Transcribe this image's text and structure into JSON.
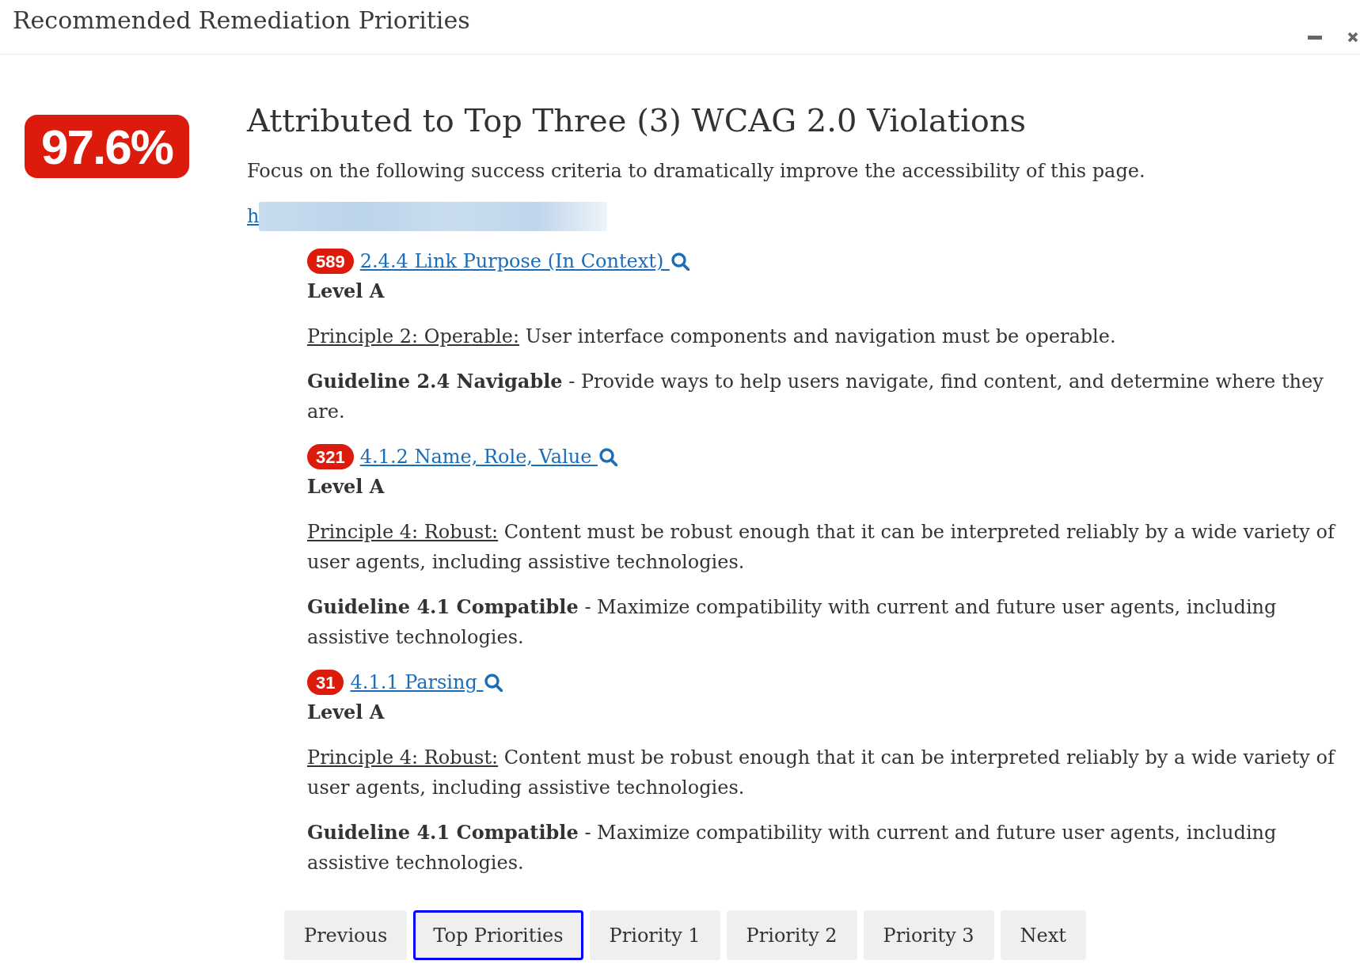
{
  "window": {
    "title": "Recommended Remediation Priorities"
  },
  "score": {
    "value": "97.6%"
  },
  "heading": "Attributed to Top Three (3) WCAG 2.0 Violations",
  "intro": "Focus on the following success criteria to dramatically improve the accessibility of this page.",
  "page_link": {
    "text": "h",
    "redacted": true
  },
  "criteria": [
    {
      "count": "589",
      "title": "2.4.4 Link Purpose (In Context)",
      "level": "Level A",
      "principle": {
        "label": "Principle 2: Operable:",
        "text": "User interface components and navigation must be operable."
      },
      "guideline": "**Guideline 2.4 Navigable** - Provide ways to help users navigate, find content, and determine where they are."
    },
    {
      "count": "321",
      "title": "4.1.2 Name, Role, Value",
      "level": "Level A",
      "principle": {
        "label": "Principle 4: Robust:",
        "text": "Content must be robust enough that it can be interpreted reliably by a wide variety of user agents, including assistive technologies."
      },
      "guideline": "**Guideline 4.1 Compatible** - Maximize compatibility with current and future user agents, including assistive technologies."
    },
    {
      "count": "31",
      "title": "4.1.1 Parsing",
      "level": "Level A",
      "principle": {
        "label": "Principle 4: Robust:",
        "text": "Content must be robust enough that it can be interpreted reliably by a wide variety of user agents, including assistive technologies."
      },
      "guideline": "**Guideline 4.1 Compatible** - Maximize compatibility with current and future user agents, including assistive technologies."
    }
  ],
  "nav_buttons": [
    {
      "label": "Previous",
      "selected": false
    },
    {
      "label": "Top Priorities",
      "selected": true
    },
    {
      "label": "Priority 1",
      "selected": false
    },
    {
      "label": "Priority 2",
      "selected": false
    },
    {
      "label": "Priority 3",
      "selected": false
    },
    {
      "label": "Next",
      "selected": false
    }
  ]
}
